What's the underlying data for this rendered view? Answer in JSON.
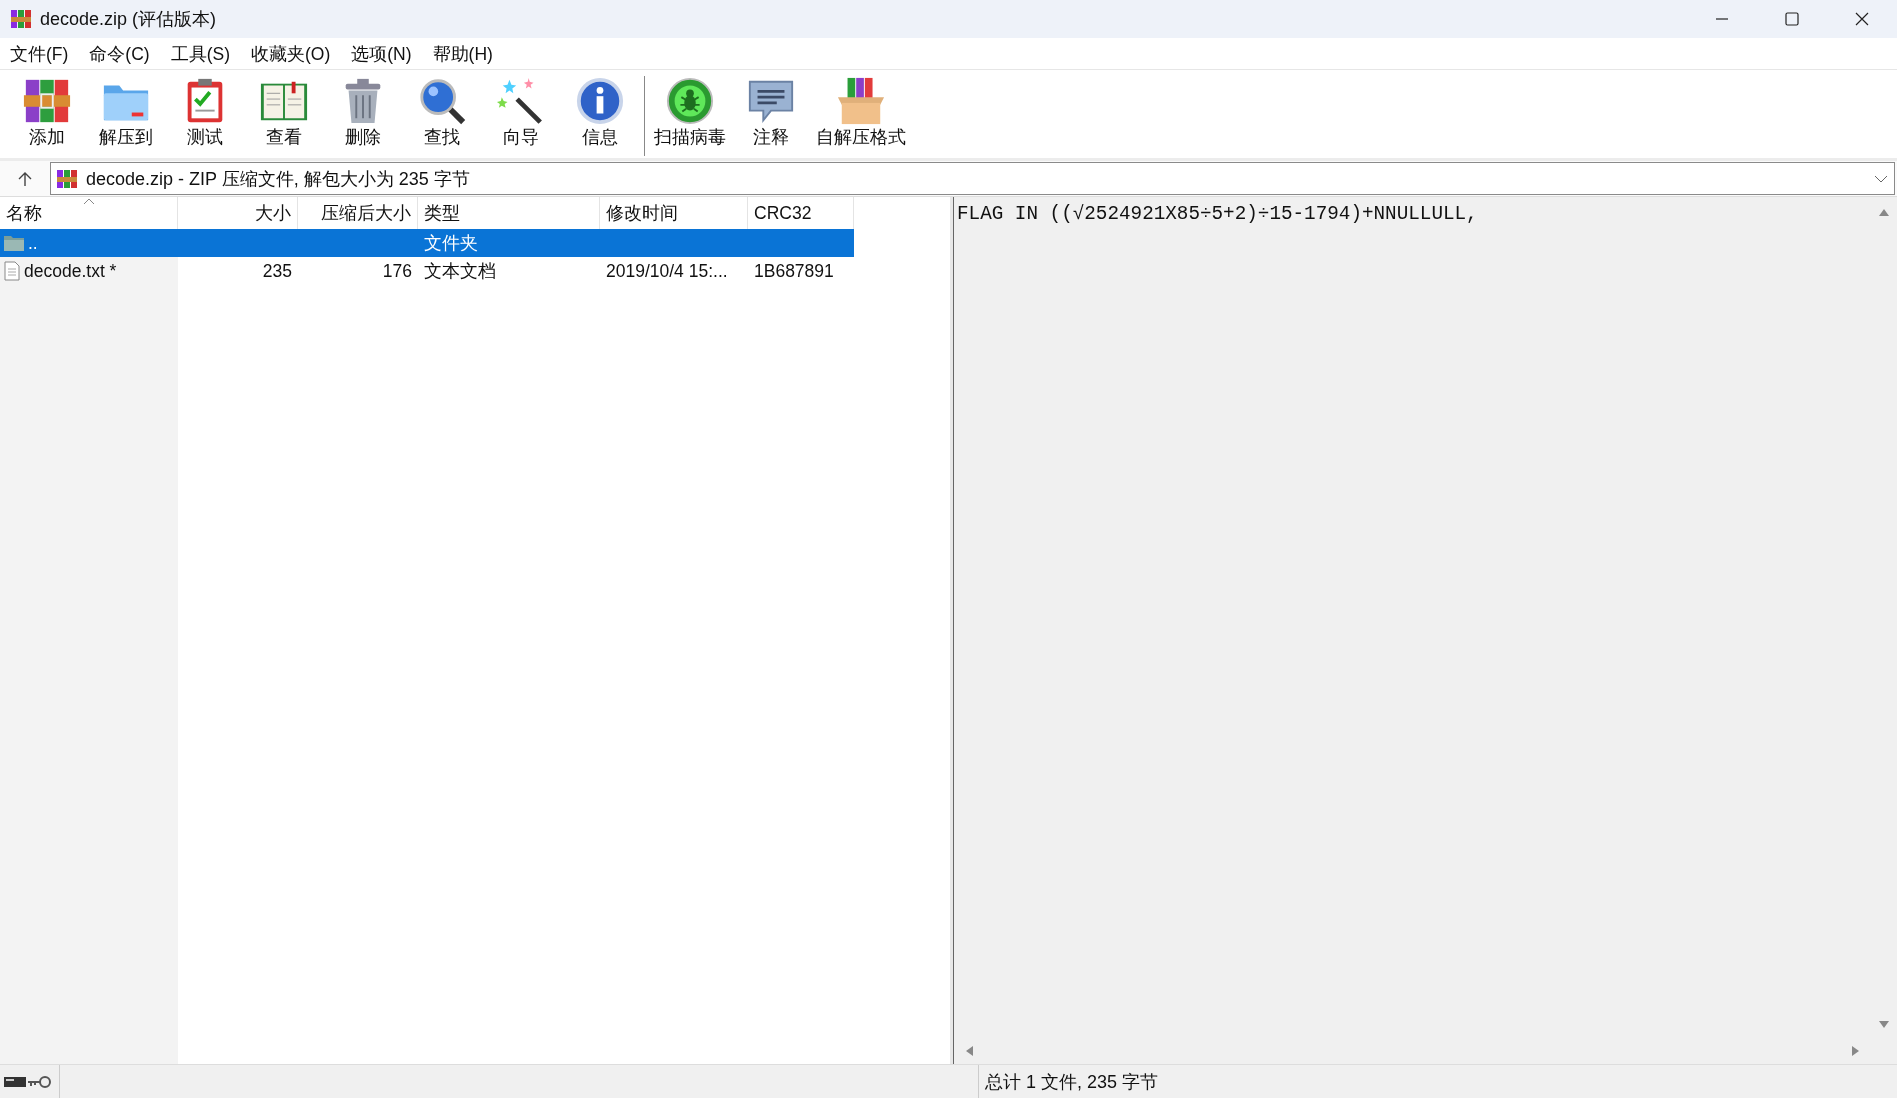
{
  "window": {
    "title": "decode.zip (评估版本)"
  },
  "menu": [
    "文件(F)",
    "命令(C)",
    "工具(S)",
    "收藏夹(O)",
    "选项(N)",
    "帮助(H)"
  ],
  "toolbar": [
    {
      "kind": "add",
      "label": "添加"
    },
    {
      "kind": "extract",
      "label": "解压到"
    },
    {
      "kind": "test",
      "label": "测试"
    },
    {
      "kind": "view",
      "label": "查看"
    },
    {
      "kind": "delete",
      "label": "删除"
    },
    {
      "kind": "find",
      "label": "查找"
    },
    {
      "kind": "wizard",
      "label": "向导"
    },
    {
      "kind": "info",
      "label": "信息"
    },
    {
      "kind": "separator"
    },
    {
      "kind": "virus",
      "label": "扫描病毒"
    },
    {
      "kind": "comment",
      "label": "注释"
    },
    {
      "kind": "sfx",
      "label": "自解压格式"
    }
  ],
  "address": {
    "text": "decode.zip - ZIP 压缩文件, 解包大小为 235 字节"
  },
  "table": {
    "columns": [
      {
        "label": "名称"
      },
      {
        "label": "大小"
      },
      {
        "label": "压缩后大小"
      },
      {
        "label": "类型"
      },
      {
        "label": "修改时间"
      },
      {
        "label": "CRC32"
      }
    ],
    "rows": [
      {
        "kind": "folder",
        "selected": true,
        "cells": [
          "..",
          "",
          "",
          "文件夹",
          "",
          ""
        ]
      },
      {
        "kind": "file",
        "selected": false,
        "cells": [
          "decode.txt *",
          "235",
          "176",
          "文本文档",
          "2019/10/4 15:...",
          "1B687891"
        ]
      }
    ]
  },
  "comment": {
    "text": "FLAG IN ((√2524921X85÷5+2)÷15-1794)+NNULLULL,"
  },
  "status_bar": {
    "text": "总计 1 文件, 235 字节"
  }
}
